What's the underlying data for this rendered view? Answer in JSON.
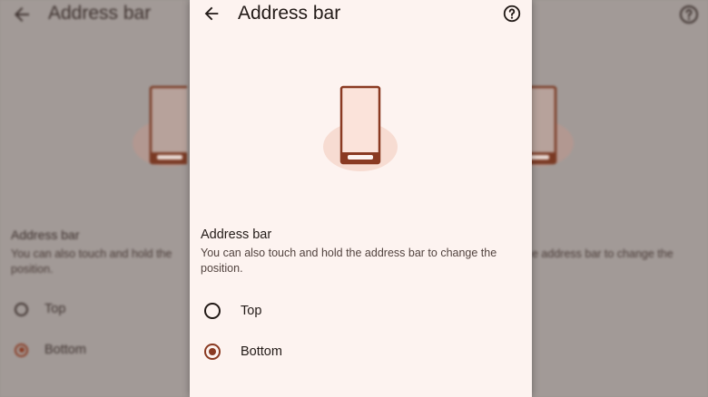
{
  "header": {
    "title": "Address bar",
    "back_icon": "arrow-back-icon",
    "help_icon": "help-circle-icon"
  },
  "section": {
    "title": "Address bar",
    "description": "You can also touch and hold the address bar to change the position."
  },
  "options": [
    {
      "label": "Top",
      "selected": false
    },
    {
      "label": "Bottom",
      "selected": true
    }
  ],
  "background_echo": {
    "title": "Address bar",
    "section_title": "Address bar",
    "desc_left": "You can also touch and hold the",
    "desc_left_line2": "position.",
    "desc_right": "e address bar to change the",
    "opt_top": "Top",
    "opt_bottom": "Bottom"
  },
  "colors": {
    "panel_bg": "#fdf3f0",
    "accent": "#8a3a22",
    "illustration_fill": "#fbe3da",
    "illustration_halo": "#f7dcd2",
    "text_primary": "#221a17",
    "dim_overlay": "#a29a97"
  }
}
